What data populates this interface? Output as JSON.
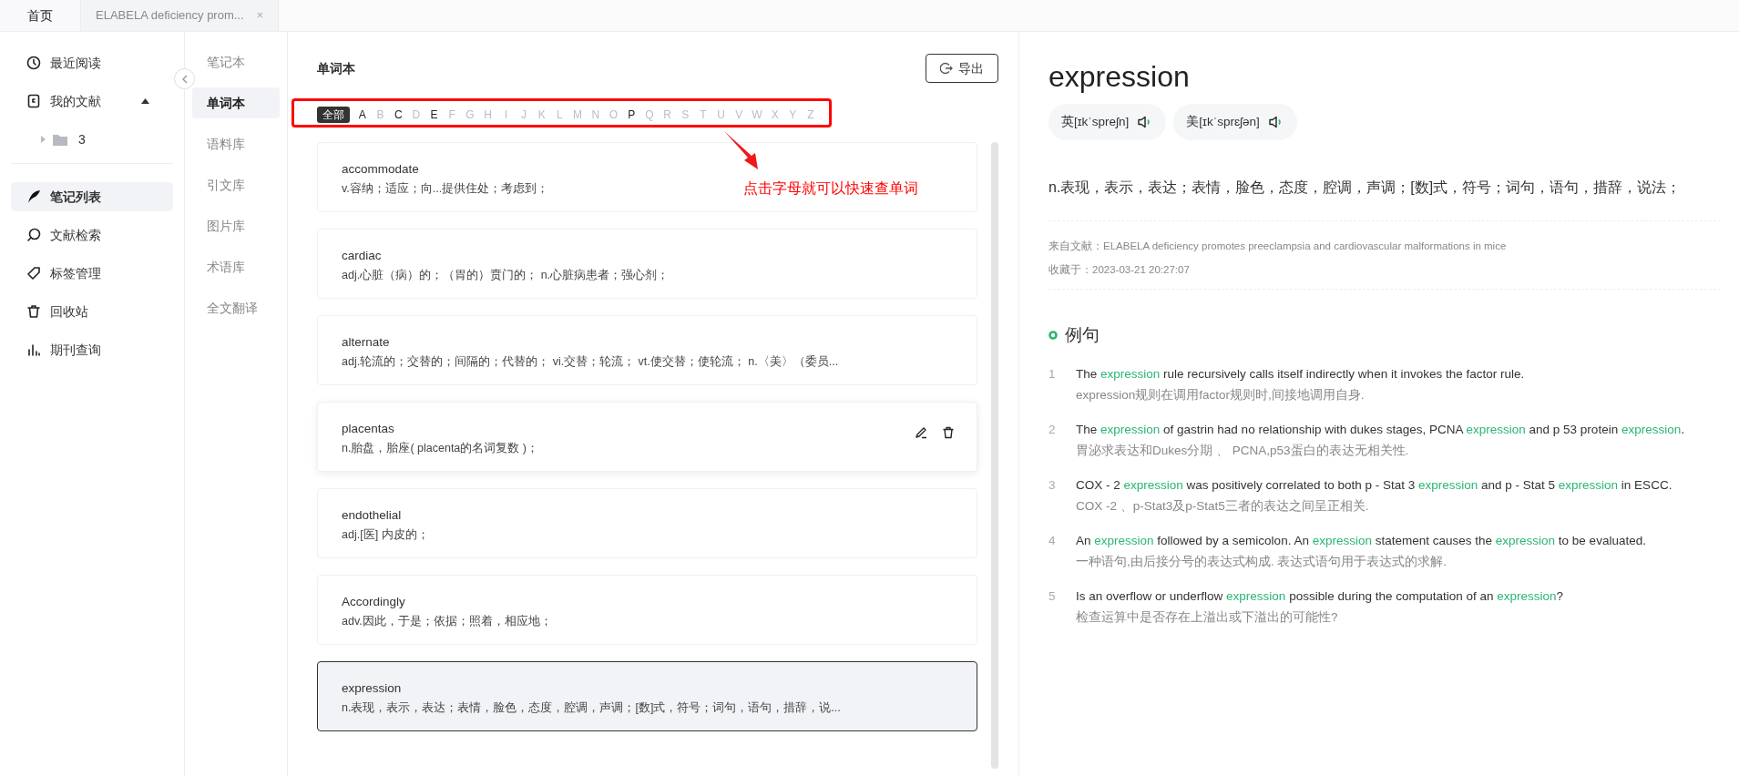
{
  "tabs": [
    {
      "label": "首页",
      "selected": true
    },
    {
      "label": "ELABELA deficiency prom...",
      "selected": false,
      "close": "×"
    }
  ],
  "sidebar": {
    "groups": [
      {
        "items": [
          {
            "label": "最近阅读",
            "selected": false
          },
          {
            "label": "我的文献",
            "selected": false,
            "expanded": true,
            "children": [
              {
                "label": "3",
                "expanded": false
              }
            ]
          }
        ]
      },
      {
        "items": [
          {
            "label": "笔记列表",
            "selected": true
          },
          {
            "label": "文献检索",
            "selected": false
          },
          {
            "label": "标签管理",
            "selected": false
          },
          {
            "label": "回收站",
            "selected": false
          },
          {
            "label": "期刊查询",
            "selected": false
          }
        ]
      }
    ]
  },
  "subnav": {
    "items": [
      {
        "label": "笔记本",
        "selected": false
      },
      {
        "label": "单词本",
        "selected": true
      },
      {
        "label": "语料库",
        "selected": false
      },
      {
        "label": "引文库",
        "selected": false
      },
      {
        "label": "图片库",
        "selected": false
      },
      {
        "label": "术语库",
        "selected": false
      },
      {
        "label": "全文翻译",
        "selected": false
      }
    ]
  },
  "wordbook": {
    "title": "单词本",
    "export_button": "导出",
    "letters": [
      {
        "label": "全部",
        "selected": true,
        "enabled": true
      },
      {
        "label": "A",
        "selected": false,
        "enabled": true
      },
      {
        "label": "B",
        "selected": false,
        "enabled": false
      },
      {
        "label": "C",
        "selected": false,
        "enabled": true
      },
      {
        "label": "D",
        "selected": false,
        "enabled": false
      },
      {
        "label": "E",
        "selected": false,
        "enabled": true
      },
      {
        "label": "F",
        "selected": false,
        "enabled": false
      },
      {
        "label": "G",
        "selected": false,
        "enabled": false
      },
      {
        "label": "H",
        "selected": false,
        "enabled": false
      },
      {
        "label": "I",
        "selected": false,
        "enabled": false
      },
      {
        "label": "J",
        "selected": false,
        "enabled": false
      },
      {
        "label": "K",
        "selected": false,
        "enabled": false
      },
      {
        "label": "L",
        "selected": false,
        "enabled": false
      },
      {
        "label": "M",
        "selected": false,
        "enabled": false
      },
      {
        "label": "N",
        "selected": false,
        "enabled": false
      },
      {
        "label": "O",
        "selected": false,
        "enabled": false
      },
      {
        "label": "P",
        "selected": false,
        "enabled": true
      },
      {
        "label": "Q",
        "selected": false,
        "enabled": false
      },
      {
        "label": "R",
        "selected": false,
        "enabled": false
      },
      {
        "label": "S",
        "selected": false,
        "enabled": false
      },
      {
        "label": "T",
        "selected": false,
        "enabled": false
      },
      {
        "label": "U",
        "selected": false,
        "enabled": false
      },
      {
        "label": "V",
        "selected": false,
        "enabled": false
      },
      {
        "label": "W",
        "selected": false,
        "enabled": false
      },
      {
        "label": "X",
        "selected": false,
        "enabled": false
      },
      {
        "label": "Y",
        "selected": false,
        "enabled": false
      },
      {
        "label": "Z",
        "selected": false,
        "enabled": false
      }
    ],
    "annotation": {
      "text": "点击字母就可以快速查单词"
    },
    "words": [
      {
        "word": "accommodate",
        "definition": "v.容纳；适应；向...提供住处；考虑到；",
        "selected": false,
        "actions_visible": false
      },
      {
        "word": "cardiac",
        "definition": "adj.心脏（病）的；（胃的）贲门的；  n.心脏病患者；强心剂；",
        "selected": false,
        "actions_visible": false
      },
      {
        "word": "alternate",
        "definition": "adj.轮流的；交替的；间隔的；代替的；  vi.交替；轮流；  vt.使交替；使轮流；  n.〈美〉（委员...",
        "selected": false,
        "actions_visible": false
      },
      {
        "word": "placentas",
        "definition": "n.胎盘，胎座( placenta的名词复数 )；",
        "selected": false,
        "actions_visible": true
      },
      {
        "word": "endothelial",
        "definition": "adj.[医] 内皮的；",
        "selected": false,
        "actions_visible": false
      },
      {
        "word": "Accordingly",
        "definition": "adv.因此，于是；依据；照着，相应地；",
        "selected": false,
        "actions_visible": false
      },
      {
        "word": "expression",
        "definition": "n.表现，表示，表达；表情，脸色，态度，腔调，声调；[数]式，符号；词句，语句，措辞，说...",
        "selected": true,
        "actions_visible": false
      }
    ]
  },
  "detail": {
    "word": "expression",
    "pronunciations": [
      {
        "label": "英[ɪkˈspreʃn]"
      },
      {
        "label": "美[ɪkˈsprɛʃən]"
      }
    ],
    "definition": "n.表现，表示，表达；表情，脸色，态度，腔调，声调；[数]式，符号；词句，语句，措辞，说法；",
    "source": "来自文献：ELABELA deficiency promotes preeclampsia and cardiovascular malformations in mice",
    "saved_at": "收藏于：2023-03-21 20:27:07",
    "examples_title": "例句",
    "examples": [
      {
        "number": "1",
        "en": "The **expression** rule recursively calls itself indirectly when it invokes the factor rule.",
        "zh": "expression规则在调用factor规则时,间接地调用自身."
      },
      {
        "number": "2",
        "en": "The **expression** of gastrin had no relationship with dukes stages, PCNA **expression** and p 53 protein **expression**.",
        "zh": "胃泌求表达和Dukes分期 、 PCNA,p53蛋白的表达无相关性."
      },
      {
        "number": "3",
        "en": "COX - 2 **expression** was positively correlated to both p - Stat 3 **expression** and p - Stat 5 **expression** in ESCC.",
        "zh": "COX -2 、p-Stat3及p-Stat5三者的表达之间呈正相关."
      },
      {
        "number": "4",
        "en": "An **expression** followed by a semicolon. An **expression** statement causes the **expression** to be evaluated.",
        "zh": "一种语句,由后接分号的表达式构成. 表达式语句用于表达式的求解."
      },
      {
        "number": "5",
        "en": "Is an overflow or underflow **expression** possible during the computation of an **expression**?",
        "zh": "检查运算中是否存在上溢出或下溢出的可能性?"
      }
    ]
  }
}
